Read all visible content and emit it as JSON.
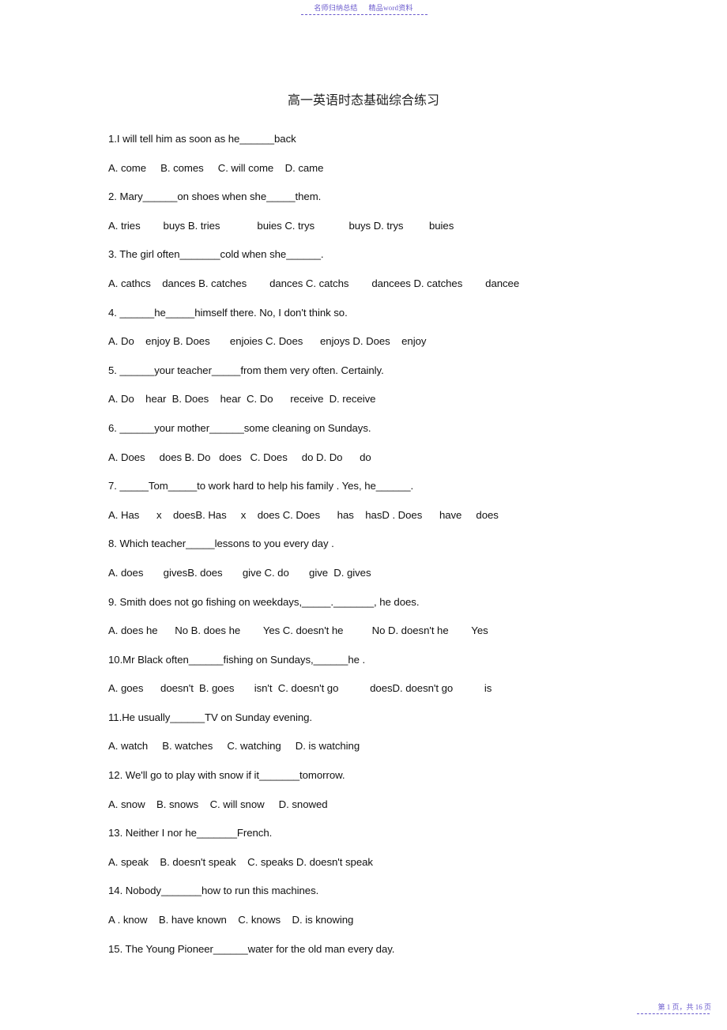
{
  "header": {
    "watermark_left": "名师归纳总结",
    "watermark_right": "精品word资料"
  },
  "footer": {
    "page_indicator": "第 1 页，共 16 页"
  },
  "document": {
    "title": "高一英语时态基础综合练习",
    "questions": [
      {
        "stem": "1.I will tell him as soon as he______back",
        "options": "A. come     B. comes     C. will come    D. came"
      },
      {
        "stem": "2. Mary______on shoes when she_____them.",
        "options": "A. tries        buys B. tries             buies C. trys            buys D. trys         buies"
      },
      {
        "stem": "3. The girl often_______cold when she______.",
        "options": "A. cathcs    dances B. catches        dances C. catchs        dancees D. catches        dancee"
      },
      {
        "stem": "4. ______he_____himself there. No, I don't think so.",
        "options": "A. Do    enjoy B. Does       enjoies C. Does      enjoys D. Does    enjoy"
      },
      {
        "stem": "5. ______your teacher_____from them very often. Certainly.",
        "options": "A. Do    hear  B. Does    hear  C. Do      receive  D. receive"
      },
      {
        "stem": "6. ______your mother______some cleaning on Sundays.",
        "options": "A. Does     does B. Do   does   C. Does     do D. Do      do"
      },
      {
        "stem": "7. _____Tom_____to work hard to help his family . Yes, he______.",
        "options": "A. Has      x    doesB. Has     x    does C. Does      has    hasD . Does      have     does"
      },
      {
        "stem": "8. Which teacher_____lessons to you every day .",
        "options": "A. does       givesB. does       give C. do       give  D. gives"
      },
      {
        "stem": "9. Smith does not go fishing on weekdays,_____._______, he does.",
        "options": "A. does he      No B. does he        Yes C. doesn't he          No D. doesn't he        Yes"
      },
      {
        "stem": "10.Mr Black often______fishing on Sundays,______he .",
        "options": "A. goes      doesn't  B. goes       isn't  C. doesn't go           doesD. doesn't go           is"
      },
      {
        "stem": "11.He usually______TV on Sunday evening.",
        "options": "A. watch     B. watches     C. watching     D. is watching"
      },
      {
        "stem": "12. We'll go to play with snow if it_______tomorrow.",
        "options": "A. snow    B. snows    C. will snow     D. snowed"
      },
      {
        "stem": "13. Neither I nor he_______French.",
        "options": "A. speak    B. doesn't speak    C. speaks D. doesn't speak"
      },
      {
        "stem": "14. Nobody_______how to run this machines.",
        "options": "A . know    B. have known    C. knows    D. is knowing"
      },
      {
        "stem": "15. The Young Pioneer______water for the old man every day.",
        "options": ""
      }
    ]
  }
}
